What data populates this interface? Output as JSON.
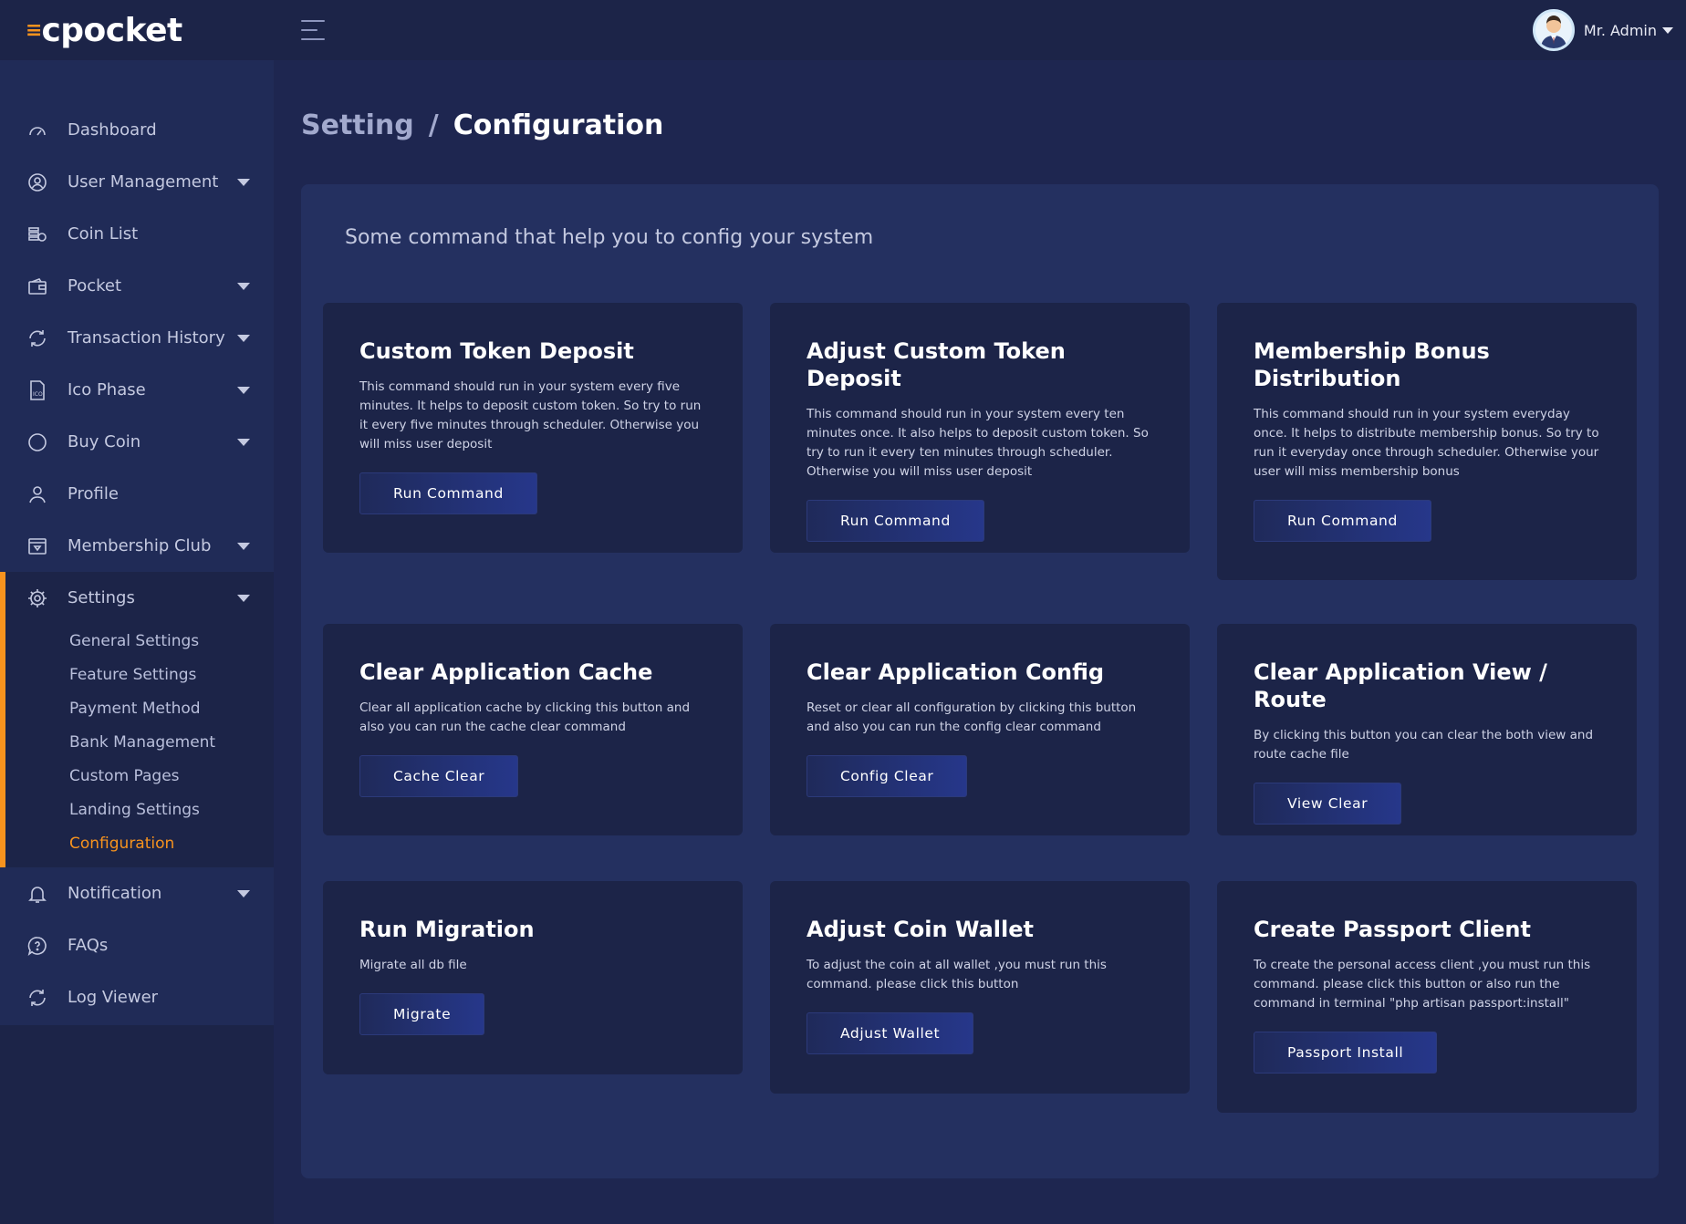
{
  "brand": {
    "logo_text": "cpocket",
    "accent_color": "#f7931e"
  },
  "header": {
    "user_name": "Mr. Admin"
  },
  "sidebar": {
    "items": [
      {
        "label": "Dashboard",
        "icon": "dashboard-icon",
        "has_children": false
      },
      {
        "label": "User Management",
        "icon": "user-circle-icon",
        "has_children": true
      },
      {
        "label": "Coin List",
        "icon": "coin-list-icon",
        "has_children": false
      },
      {
        "label": "Pocket",
        "icon": "wallet-icon",
        "has_children": true
      },
      {
        "label": "Transaction History",
        "icon": "transaction-icon",
        "has_children": true
      },
      {
        "label": "Ico Phase",
        "icon": "ico-icon",
        "has_children": true
      },
      {
        "label": "Buy Coin",
        "icon": "circle-icon",
        "has_children": true
      },
      {
        "label": "Profile",
        "icon": "profile-icon",
        "has_children": false
      },
      {
        "label": "Membership Club",
        "icon": "membership-icon",
        "has_children": true
      }
    ],
    "settings": {
      "label": "Settings",
      "icon": "gear-icon",
      "children": [
        "General Settings",
        "Feature Settings",
        "Payment Method",
        "Bank Management",
        "Custom Pages",
        "Landing Settings",
        "Configuration"
      ],
      "active_child": "Configuration"
    },
    "items_after": [
      {
        "label": "Notification",
        "icon": "bell-icon",
        "has_children": true
      },
      {
        "label": "FAQs",
        "icon": "question-icon",
        "has_children": false
      },
      {
        "label": "Log Viewer",
        "icon": "log-icon",
        "has_children": false
      }
    ]
  },
  "breadcrumb": {
    "parent": "Setting",
    "separator": "/",
    "current": "Configuration"
  },
  "panel": {
    "title": "Some command that help you to config your system",
    "cards": [
      {
        "title": "Custom Token Deposit",
        "description": "This command should run in your system every five minutes. It helps to deposit custom token. So try to run it every five minutes through scheduler. Otherwise you will miss user deposit",
        "button": "Run Command"
      },
      {
        "title": "Adjust Custom Token Deposit",
        "description": "This command should run in your system every ten minutes once. It also helps to deposit custom token. So try to run it every ten minutes through scheduler. Otherwise you will miss user deposit",
        "button": "Run Command"
      },
      {
        "title": "Membership Bonus Distribution",
        "description": "This command should run in your system everyday once. It helps to distribute membership bonus. So try to run it everyday once through scheduler. Otherwise your user will miss membership bonus",
        "button": "Run Command"
      },
      {
        "title": "Clear Application Cache",
        "description": "Clear all application cache by clicking this button and also you can run the cache clear command",
        "button": "Cache Clear"
      },
      {
        "title": "Clear Application Config",
        "description": "Reset or clear all configuration by clicking this button and also you can run the config clear command",
        "button": "Config Clear"
      },
      {
        "title": "Clear Application View / Route",
        "description": "By clicking this button you can clear the both view and route cache file",
        "button": "View Clear"
      },
      {
        "title": "Run Migration",
        "description": "Migrate all db file",
        "button": "Migrate"
      },
      {
        "title": "Adjust Coin Wallet",
        "description": "To adjust the coin at all wallet ,you must run this command. please click this button",
        "button": "Adjust Wallet"
      },
      {
        "title": "Create Passport Client",
        "description": "To create the personal access client ,you must run this command. please click this button or also run the command in terminal \"php artisan passport:install\"",
        "button": "Passport Install"
      }
    ]
  }
}
